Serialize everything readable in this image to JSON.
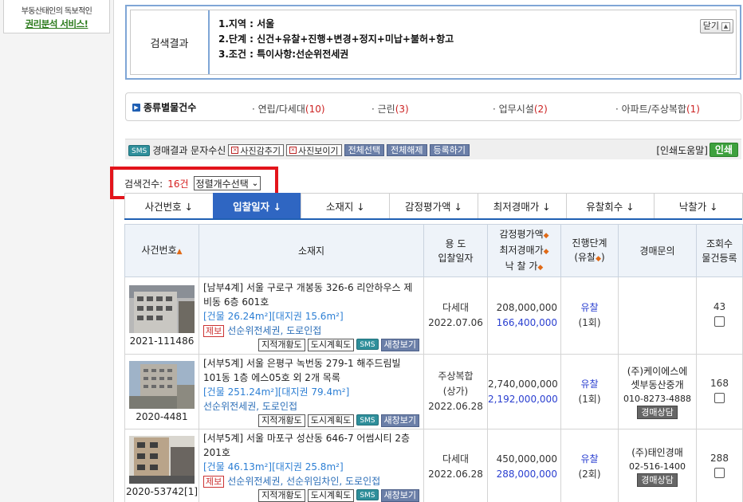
{
  "sidebar": {
    "promo_line1": "부동산태인의 독보적인",
    "promo_line2": "권리분석 서비스!"
  },
  "search_result": {
    "label": "검색결과",
    "conditions": [
      "1.지역 : 서울",
      "2.단계 : 신건+유찰+진행+변경+정지+미납+불허+항고",
      "3.조건 : 특이사항:선순위전세권"
    ],
    "fold_label": "닫기"
  },
  "type_counts": {
    "title": "종류별물건수",
    "items": [
      {
        "name": "연립/다세대",
        "count": "(10)"
      },
      {
        "name": "근린",
        "count": "(3)"
      },
      {
        "name": "업무시설",
        "count": "(2)"
      },
      {
        "name": "아파트/주상복합",
        "count": "(1)"
      }
    ]
  },
  "toolbar": {
    "sms_badge": "SMS",
    "sms_text": "경매결과 문자수신",
    "hide_photos": "사진감추기",
    "show_photos": "사진보이기",
    "select_all": "전체선택",
    "deselect_all": "전체해제",
    "register": "등록하기",
    "print_help": "[인쇄도움말]",
    "print": "인쇄"
  },
  "count_row": {
    "prefix": "검색건수:",
    "count": "16건",
    "sort_select": "정렬개수선택"
  },
  "sort_tabs": [
    {
      "label": "사건번호 ↓",
      "active": false
    },
    {
      "label": "입찰일자 ↓",
      "active": true
    },
    {
      "label": "소재지 ↓",
      "active": false
    },
    {
      "label": "감정평가액 ↓",
      "active": false
    },
    {
      "label": "최저경매가 ↓",
      "active": false
    },
    {
      "label": "유찰회수 ↓",
      "active": false
    },
    {
      "label": "낙찰가 ↓",
      "active": false
    }
  ],
  "table": {
    "headers": {
      "case": "사건번호",
      "location": "소재지",
      "use_line1": "용 도",
      "use_line2": "입찰일자",
      "price_line1": "감정평가액",
      "price_line2": "최저경매가",
      "price_line3": "낙 찰 가",
      "stage_line1": "진행단계",
      "stage_line2_a": "(유찰",
      "stage_line2_b": ")",
      "inquiry": "경매문의",
      "views_line1": "조회수",
      "views_line2": "물건등록"
    },
    "rows": [
      {
        "case_no": "2021-111486",
        "court": "[남부4계]",
        "address": "서울 구로구 개봉동 326-6 리안하우스 제비동 6층 601호",
        "area": "[건물 26.24m²][대지권 15.6m²]",
        "report": "제보",
        "features": "선순위전세권, 도로인접",
        "use": "다세대",
        "date": "2022.07.06",
        "appraisal": "208,000,000",
        "minimum": "166,400,000",
        "stage": "유찰",
        "stage_count": "(1회)",
        "inquiry_name": "",
        "inquiry_name2": "",
        "inquiry_phone": "",
        "inquiry_btn": "",
        "views": "43"
      },
      {
        "case_no": "2020-4481",
        "court": "[서부5계]",
        "address": "서울 은평구 녹번동 279-1 해주드림빌 101동 1층 에스05호 외 2개 목록",
        "area": "[건물 251.24m²][대지권 79.4m²]",
        "report": "",
        "features": "선순위전세권, 도로인접",
        "use": "주상복합",
        "use2": "(상가)",
        "date": "2022.06.28",
        "appraisal": "2,740,000,000",
        "minimum": "2,192,000,000",
        "stage": "유찰",
        "stage_count": "(1회)",
        "inquiry_name": "(주)케이에스에",
        "inquiry_name2": "셋부동산중개",
        "inquiry_phone": "010-8273-4888",
        "inquiry_btn": "경매상담",
        "views": "168"
      },
      {
        "case_no": "2020-53742[1]",
        "court": "[서부5계]",
        "address": "서울 마포구 성산동 646-7 어썸시티 2층 201호",
        "area": "[건물 46.13m²][대지권 25.8m²]",
        "report": "제보",
        "features": "선순위전세권, 선순위임차인, 도로인접",
        "use": "다세대",
        "date": "2022.06.28",
        "appraisal": "450,000,000",
        "minimum": "288,000,000",
        "stage": "유찰",
        "stage_count": "(2회)",
        "inquiry_name": "(주)태인경매",
        "inquiry_name2": "",
        "inquiry_phone": "02-516-1400",
        "inquiry_btn": "경매상담",
        "views": "288"
      }
    ],
    "row_buttons": {
      "cadastral": "지적개황도",
      "city_plan": "도시계획도",
      "sms": "SMS",
      "new_window": "새창보기"
    }
  },
  "colors": {
    "accent_blue": "#2f66c2",
    "highlight_red": "#e3141b",
    "min_price_blue": "#2a3fd0"
  }
}
